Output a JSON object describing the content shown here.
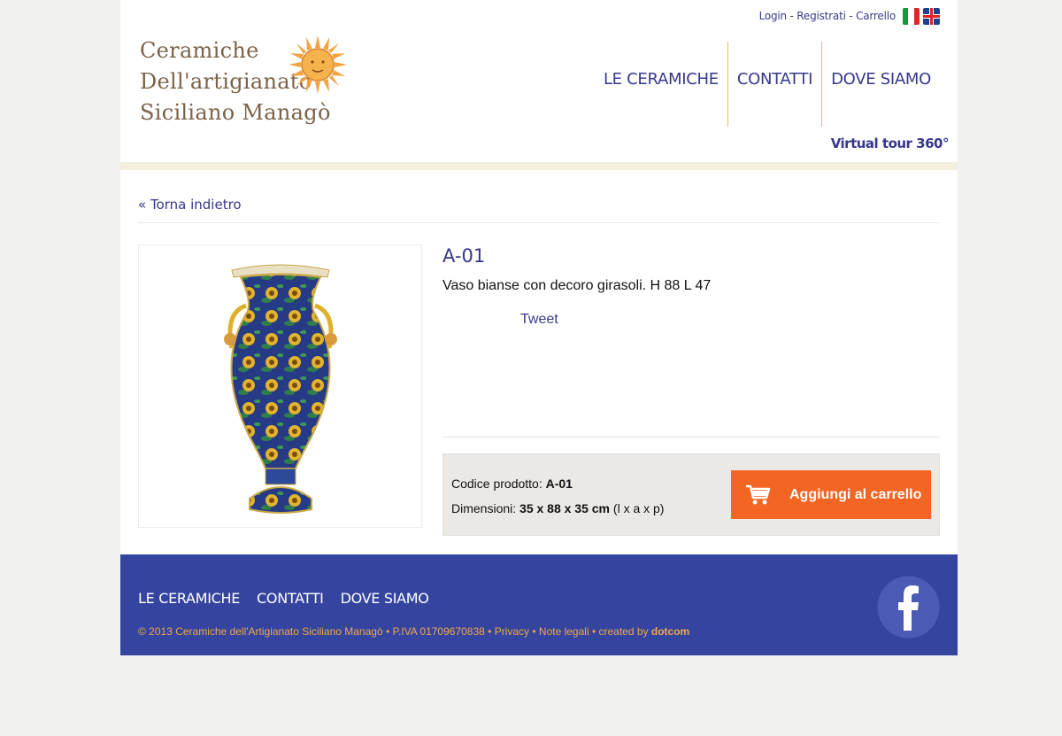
{
  "header": {
    "toplinks": {
      "login": "Login",
      "sep1": " - ",
      "register": "Registrati",
      "sep2": " - ",
      "cart": "Carrello"
    },
    "logo": {
      "line1": "Ceramiche",
      "line2": "Dell'artigianato",
      "line3": "Siciliano Managò"
    },
    "nav": [
      "LE CERAMICHE",
      "CONTATTI",
      "DOVE SIAMO"
    ],
    "virtual_tour": "Virtual tour 360°"
  },
  "main": {
    "back_link": "« Torna indietro",
    "product": {
      "code": "A-01",
      "description": "Vaso bianse con decoro girasoli. H 88 L 47",
      "tweet": "Tweet",
      "code_label": "Codice prodotto: ",
      "code_value": "A-01",
      "dim_label": "Dimensioni: ",
      "dim_value": "35 x 88 x 35 cm",
      "dim_suffix": " (l x a x p)",
      "add_to_cart": "Aggiungi al carrello"
    }
  },
  "footer": {
    "nav": [
      "LE CERAMICHE",
      "CONTATTI",
      "DOVE SIAMO"
    ],
    "copyright": "© 2013 Ceramiche dell'Artigianato Siciliano Managò • P.IVA 01709670838 • ",
    "privacy": "Privacy",
    "sep": " • ",
    "legal": "Note legali",
    "created": " • created by ",
    "agency": "dotcom"
  },
  "colors": {
    "accent": "#36388d",
    "cart_button": "#f26522",
    "footer_bg": "#35459f",
    "footer_text": "#f0a64b"
  },
  "icons": {
    "flag_it": "italian-flag-icon",
    "flag_uk": "uk-flag-icon",
    "cart": "cart-icon",
    "facebook": "facebook-icon",
    "sun": "sun-logo-icon"
  }
}
